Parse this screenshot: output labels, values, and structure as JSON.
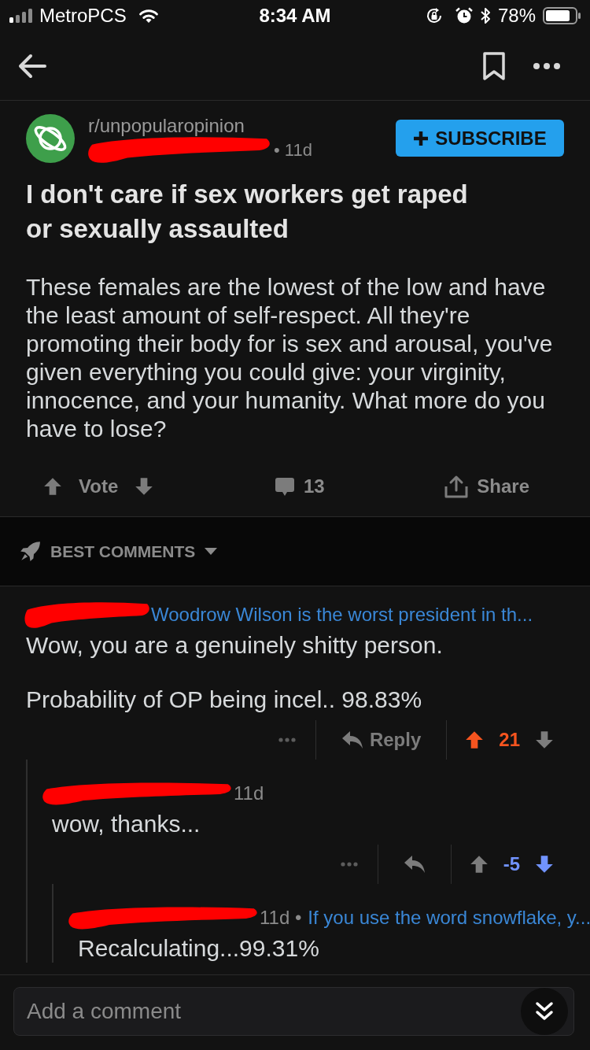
{
  "status_bar": {
    "carrier": "MetroPCS",
    "time": "8:34 AM",
    "battery": "78%"
  },
  "post": {
    "subreddit": "r/unpopularopinion",
    "author_redacted": true,
    "age": "• 11d",
    "subscribe_label": "SUBSCRIBE",
    "title": "I don't care if sex workers get raped or sexually assaulted",
    "body": "These females are the lowest of the low and have the least amount of self-respect. All they're promoting their body for is sex and arousal, you've given everything you could give: your virginity, innocence, and your humanity. What more do you have to lose?",
    "vote_label": "Vote",
    "upvoted": false,
    "downvoted": false,
    "comment_count": "13",
    "share_label": "Share"
  },
  "sort": {
    "label": "BEST COMMENTS"
  },
  "comments": [
    {
      "author_redacted": true,
      "flair": "Woodrow Wilson is the worst president in th...",
      "body": [
        "Wow, you are a genuinely shitty person.",
        "Probability of OP being incel.. 98.83%"
      ],
      "actions": {
        "reply_label": "Reply",
        "score": "21",
        "upvoted": true,
        "downvoted": false
      },
      "children": [
        {
          "author_redacted": true,
          "meta": "11d",
          "body": [
            "wow, thanks..."
          ],
          "actions": {
            "score": "-5",
            "upvoted": false,
            "downvoted": true
          },
          "children": [
            {
              "author_redacted": true,
              "meta": "11d •",
              "flair": "If you use the word snowflake, y...",
              "body": [
                "Recalculating...99.31%"
              ]
            }
          ]
        }
      ]
    }
  ],
  "comment_box": {
    "placeholder": "Add a comment"
  }
}
